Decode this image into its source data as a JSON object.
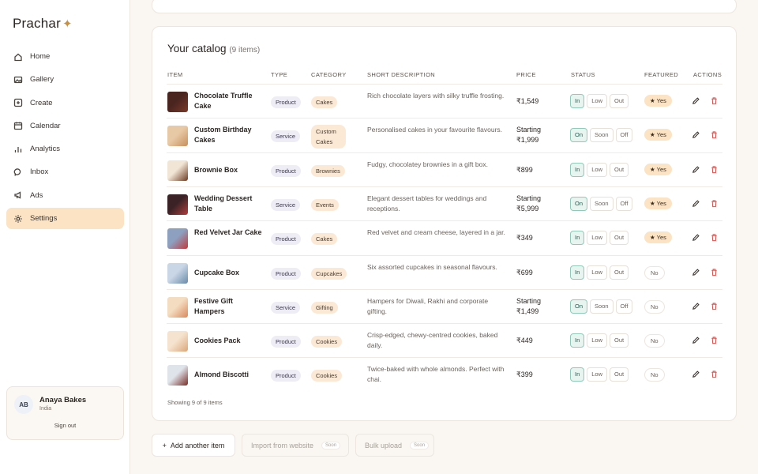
{
  "app": {
    "name": "Prachar",
    "logo_star": "✦"
  },
  "nav": [
    {
      "label": "Home",
      "icon": "home-icon"
    },
    {
      "label": "Gallery",
      "icon": "gallery-icon"
    },
    {
      "label": "Create",
      "icon": "plus-square-icon"
    },
    {
      "label": "Calendar",
      "icon": "calendar-icon"
    },
    {
      "label": "Analytics",
      "icon": "bar-chart-icon"
    },
    {
      "label": "Inbox",
      "icon": "chat-icon"
    },
    {
      "label": "Ads",
      "icon": "megaphone-icon"
    },
    {
      "label": "Settings",
      "icon": "gear-icon",
      "active": true
    }
  ],
  "user": {
    "initials": "AB",
    "name": "Anaya Bakes",
    "location": "India",
    "signout": "Sign out"
  },
  "catalog": {
    "title": "Your catalog",
    "count": "(9 items)",
    "columns": {
      "item": "ITEM",
      "type": "TYPE",
      "category": "CATEGORY",
      "description": "SHORT DESCRIPTION",
      "price": "PRICE",
      "status": "STATUS",
      "featured": "FEATURED",
      "actions": "ACTIONS"
    },
    "rows": [
      {
        "name": "Chocolate Truffle Cake",
        "type": "Product",
        "category": "Cakes",
        "description": "Rich chocolate layers with silky truffle frosting.",
        "price": "₹1,549",
        "status_options": [
          "In",
          "Low",
          "Out"
        ],
        "status_selected": 0,
        "featured": "★ Yes",
        "featured_on": true
      },
      {
        "name": "Custom Birthday Cakes",
        "type": "Service",
        "category": "Custom Cakes",
        "description": "Personalised cakes in your favourite flavours.",
        "price": "Starting ₹1,999",
        "status_options": [
          "On",
          "Soon",
          "Off"
        ],
        "status_selected": 0,
        "featured": "★ Yes",
        "featured_on": true
      },
      {
        "name": "Brownie Box",
        "type": "Product",
        "category": "Brownies",
        "description": "Fudgy, chocolatey brownies in a gift box.",
        "price": "₹899",
        "status_options": [
          "In",
          "Low",
          "Out"
        ],
        "status_selected": 0,
        "featured": "★ Yes",
        "featured_on": true
      },
      {
        "name": "Wedding Dessert Table",
        "type": "Service",
        "category": "Events",
        "description": "Elegant dessert tables for weddings and receptions.",
        "price": "Starting ₹5,999",
        "status_options": [
          "On",
          "Soon",
          "Off"
        ],
        "status_selected": 0,
        "featured": "★ Yes",
        "featured_on": true
      },
      {
        "name": "Red Velvet Jar Cake",
        "type": "Product",
        "category": "Cakes",
        "description": "Red velvet and cream cheese, layered in a jar.",
        "price": "₹349",
        "status_options": [
          "In",
          "Low",
          "Out"
        ],
        "status_selected": 0,
        "featured": "★ Yes",
        "featured_on": true
      },
      {
        "name": "Cupcake Box",
        "type": "Product",
        "category": "Cupcakes",
        "description": "Six assorted cupcakes in seasonal flavours.",
        "price": "₹699",
        "status_options": [
          "In",
          "Low",
          "Out"
        ],
        "status_selected": 0,
        "featured": "No",
        "featured_on": false
      },
      {
        "name": "Festive Gift Hampers",
        "type": "Service",
        "category": "Gifting",
        "description": "Hampers for Diwali, Rakhi and corporate gifting.",
        "price": "Starting ₹1,499",
        "status_options": [
          "On",
          "Soon",
          "Off"
        ],
        "status_selected": 0,
        "featured": "No",
        "featured_on": false
      },
      {
        "name": "Cookies Pack",
        "type": "Product",
        "category": "Cookies",
        "description": "Crisp-edged, chewy-centred cookies, baked daily.",
        "price": "₹449",
        "status_options": [
          "In",
          "Low",
          "Out"
        ],
        "status_selected": 0,
        "featured": "No",
        "featured_on": false
      },
      {
        "name": "Almond Biscotti",
        "type": "Product",
        "category": "Cookies",
        "description": "Twice-baked with whole almonds. Perfect with chai.",
        "price": "₹399",
        "status_options": [
          "In",
          "Low",
          "Out"
        ],
        "status_selected": 0,
        "featured": "No",
        "featured_on": false
      }
    ],
    "showing": "Showing 9 of 9 items"
  },
  "actions": {
    "add": "Add another item",
    "add_icon": "+",
    "import": "Import from website",
    "bulk": "Bulk upload",
    "soon": "Soon"
  },
  "colors": {
    "accent": "#fbe3c4",
    "status_selected": "#e7f4f0",
    "delete": "#d9534f"
  }
}
